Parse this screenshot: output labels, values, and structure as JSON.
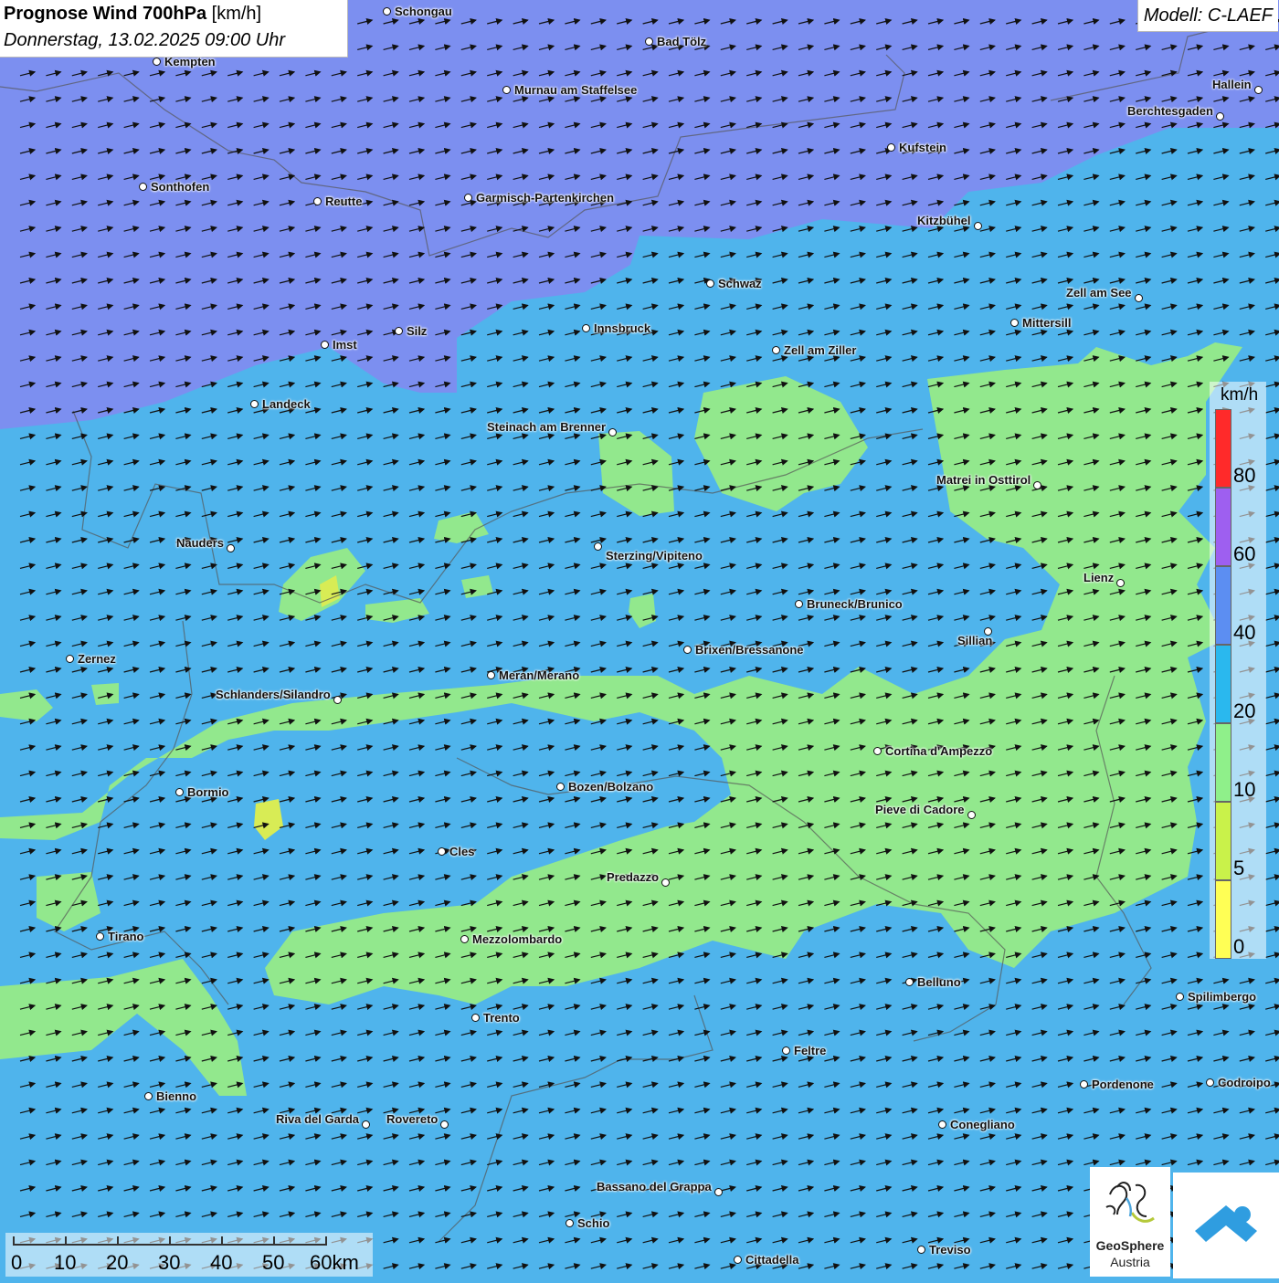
{
  "title": {
    "bold": "Prognose Wind 700hPa",
    "unit": " [km/h]",
    "date": "Donnerstag, 13.02.2025 09:00 Uhr"
  },
  "model": "Modell: C-LAEF",
  "legend": {
    "unit": "km/h",
    "ticks": [
      "80",
      "60",
      "40",
      "20",
      "10",
      "5",
      "0"
    ],
    "colors": [
      "#ff2a2a",
      "#9e5ff0",
      "#5c8ef2",
      "#2ab8ee",
      "#8ff08a",
      "#c9f24a",
      "#ffff55"
    ]
  },
  "scale": {
    "labels": [
      "0",
      "10",
      "20",
      "30",
      "40",
      "50",
      "60km"
    ]
  },
  "logo": {
    "name": "GeoSphere",
    "sub": "Austria"
  },
  "zones": {
    "purple": "#7c8ff0",
    "blue": "#4fb4ec",
    "green": "#92e88d"
  },
  "wind": {
    "direction": "west-southwest",
    "unit": "km/h"
  },
  "cities": [
    {
      "name": "Schongau"
    },
    {
      "name": "Bad Tölz"
    },
    {
      "name": "Kempten"
    },
    {
      "name": "Murnau am Staffelsee"
    },
    {
      "name": "Hallein"
    },
    {
      "name": "Berchtesgaden"
    },
    {
      "name": "Kufstein"
    },
    {
      "name": "Sonthofen"
    },
    {
      "name": "Reutte"
    },
    {
      "name": "Garmisch-Partenkirchen"
    },
    {
      "name": "Kitzbühel"
    },
    {
      "name": "Schwaz"
    },
    {
      "name": "Zell am See"
    },
    {
      "name": "Mittersill"
    },
    {
      "name": "Innsbruck"
    },
    {
      "name": "Silz"
    },
    {
      "name": "Imst"
    },
    {
      "name": "Zell am Ziller"
    },
    {
      "name": "Landeck"
    },
    {
      "name": "Steinach am Brenner"
    },
    {
      "name": "Matrei in Osttirol"
    },
    {
      "name": "Nauders"
    },
    {
      "name": "Sterzing/Vipiteno"
    },
    {
      "name": "Lienz"
    },
    {
      "name": "Bruneck/Brunico"
    },
    {
      "name": "Sillian"
    },
    {
      "name": "Zernez"
    },
    {
      "name": "Brixen/Bressanone"
    },
    {
      "name": "Meran/Merano"
    },
    {
      "name": "Schlanders/Silandro"
    },
    {
      "name": "Cortina d'Ampezzo"
    },
    {
      "name": "Bozen/Bolzano"
    },
    {
      "name": "Bormio"
    },
    {
      "name": "Pieve di Cadore"
    },
    {
      "name": "Cles"
    },
    {
      "name": "Predazzo"
    },
    {
      "name": "Tirano"
    },
    {
      "name": "Mezzolombardo"
    },
    {
      "name": "Belluno"
    },
    {
      "name": "Spilimbergo"
    },
    {
      "name": "Trento"
    },
    {
      "name": "Feltre"
    },
    {
      "name": "Pordenone"
    },
    {
      "name": "Codroipo"
    },
    {
      "name": "Bienno"
    },
    {
      "name": "Riva del Garda"
    },
    {
      "name": "Rovereto"
    },
    {
      "name": "Conegliano"
    },
    {
      "name": "Bassano del Grappa"
    },
    {
      "name": "Schio"
    },
    {
      "name": "Treviso"
    },
    {
      "name": "Cittadella"
    }
  ]
}
